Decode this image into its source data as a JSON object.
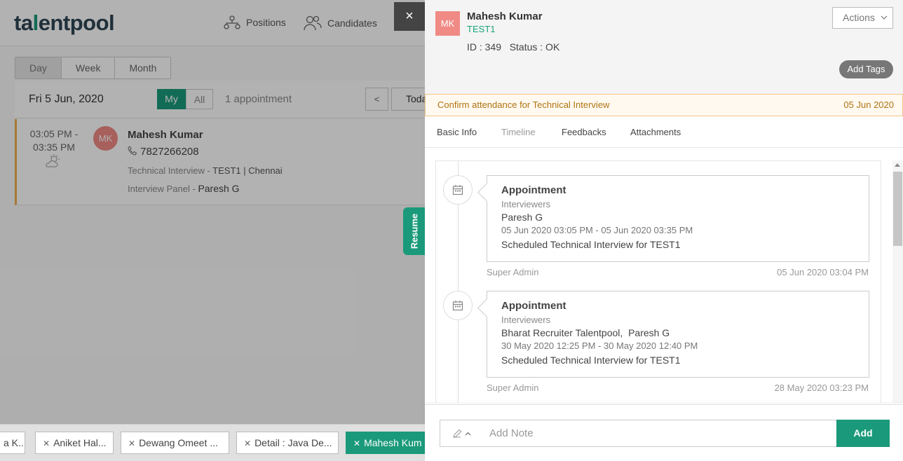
{
  "background": {
    "logo": {
      "prefix": "ta",
      "accent": "l",
      "suffix": "entpool"
    },
    "nav": [
      {
        "label": "Positions",
        "icon": "org-chart-icon"
      },
      {
        "label": "Candidates",
        "icon": "users-icon"
      }
    ],
    "view_tabs": [
      "Day",
      "Week",
      "Month"
    ],
    "calendar": {
      "date": "Fri 5 Jun, 2020",
      "my_label": "My",
      "all_label": "All",
      "count": "1 appointment",
      "prev": "<",
      "today": "Toda"
    },
    "appointment": {
      "time_start": "03:05 PM -",
      "time_end": "03:35 PM",
      "avatar": "MK",
      "name": "Mahesh Kumar",
      "phone": "7827266208",
      "type": "Technical Interview - ",
      "position": "TEST1",
      "separator": " | ",
      "location": "Chennai",
      "panel_label": "Interview Panel - ",
      "panel": "Paresh G"
    },
    "bottom_tabs": [
      {
        "label": "a K..."
      },
      {
        "label": "Aniket Hal..."
      },
      {
        "label": "Dewang Omeet ..."
      },
      {
        "label": "Detail : Java De..."
      },
      {
        "label": "Mahesh Kum"
      }
    ],
    "resume_label": "Resume",
    "close_label": "×"
  },
  "panel": {
    "avatar": "MK",
    "name": "Mahesh Kumar",
    "position": "TEST1",
    "id_status": "ID : 349   Status : OK",
    "actions_label": "Actions",
    "add_tags_label": "Add Tags",
    "confirm": {
      "text": "Confirm attendance for Technical Interview",
      "date": "05 Jun 2020"
    },
    "tabs": [
      "Basic Info",
      "Timeline",
      "Feedbacks",
      "Attachments"
    ],
    "timeline": [
      {
        "title": "Appointment",
        "label": "Interviewers",
        "people": "Paresh G",
        "range": "05 Jun 2020 03:05 PM - 05 Jun 2020 03:35 PM",
        "description": "Scheduled Technical Interview for TEST1",
        "author": "Super Admin",
        "timestamp": "05 Jun 2020 03:04 PM"
      },
      {
        "title": "Appointment",
        "label": "Interviewers",
        "people": "Bharat Recruiter Talentpool,  Paresh G",
        "range": "30 May 2020 12:25 PM - 30 May 2020 12:40 PM",
        "description": "Scheduled Technical Interview for TEST1",
        "author": "Super Admin",
        "timestamp": "28 May 2020 03:23 PM"
      }
    ],
    "note": {
      "placeholder": "Add Note",
      "add_label": "Add"
    }
  },
  "colors": {
    "brand_green": "#1a9a7a",
    "avatar_pink": "#f08a84",
    "warning_text": "#b07410"
  }
}
